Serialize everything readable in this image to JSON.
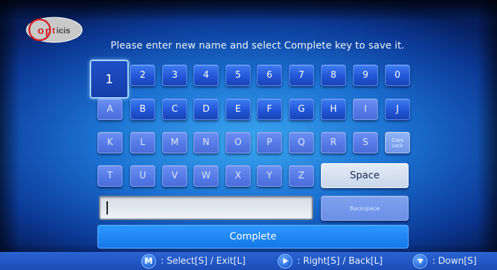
{
  "brand": {
    "logo_text": "OPTICIS"
  },
  "prompt": "Please enter new name and select Complete key to save it.",
  "keyboard": {
    "row1": [
      "1",
      "2",
      "3",
      "4",
      "5",
      "6",
      "7",
      "8",
      "9",
      "0"
    ],
    "row2": [
      "A",
      "B",
      "C",
      "D",
      "E",
      "F",
      "G",
      "H",
      "I",
      "J"
    ],
    "row3": [
      "K",
      "L",
      "M",
      "N",
      "O",
      "P",
      "Q",
      "R",
      "S"
    ],
    "caps_lock_line1": "Caps",
    "caps_lock_line2": "Lock",
    "row4": [
      "T",
      "U",
      "V",
      "W",
      "X",
      "Y",
      "Z"
    ],
    "space_label": "Space",
    "backspace_label": "Backspace",
    "selected_key": "1"
  },
  "name_input": {
    "value": ""
  },
  "complete_label": "Complete",
  "footer": {
    "hint1_key": "M",
    "hint1_text": ": Select[S] / Exit[L]",
    "hint2_icon": "right-arrow-icon",
    "hint2_text": ": Right[S] / Back[L]",
    "hint3_icon": "down-arrow-icon",
    "hint3_text": ": Down[S]"
  },
  "colors": {
    "background": "#1b6fd0",
    "key": "#2356d8",
    "selected_border": "#a9d8ff",
    "complete": "#1478e8",
    "footer": "#2a63d2"
  }
}
